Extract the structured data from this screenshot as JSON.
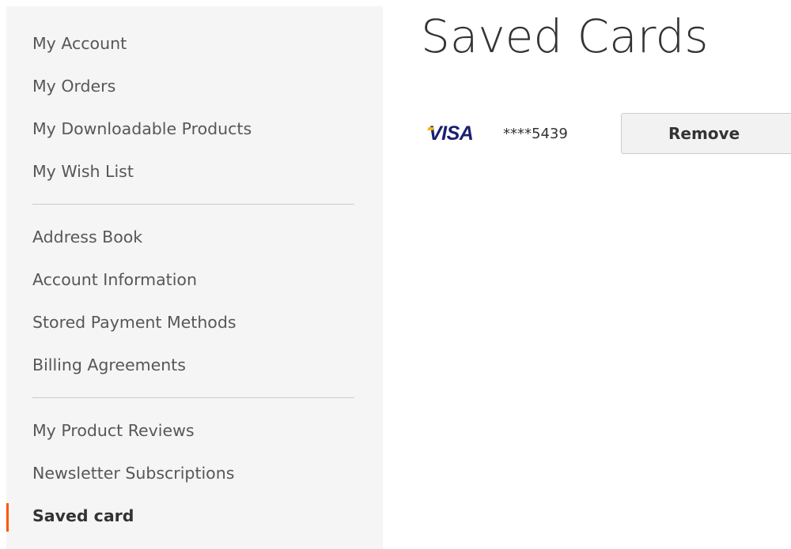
{
  "sidebar": {
    "groups": [
      {
        "items": [
          {
            "label": "My Account"
          },
          {
            "label": "My Orders"
          },
          {
            "label": "My Downloadable Products"
          },
          {
            "label": "My Wish List"
          }
        ]
      },
      {
        "items": [
          {
            "label": "Address Book"
          },
          {
            "label": "Account Information"
          },
          {
            "label": "Stored Payment Methods"
          },
          {
            "label": "Billing Agreements"
          }
        ]
      },
      {
        "items": [
          {
            "label": "My Product Reviews"
          },
          {
            "label": "Newsletter Subscriptions"
          },
          {
            "label": "Saved card"
          }
        ]
      }
    ],
    "current_item": "Saved card",
    "accent_color": "#ff5501"
  },
  "main": {
    "title": "Saved Cards",
    "cards": [
      {
        "brand": "VISA",
        "brand_icon": "visa-logo-icon",
        "masked_number": "****5439",
        "remove_label": "Remove"
      }
    ]
  }
}
